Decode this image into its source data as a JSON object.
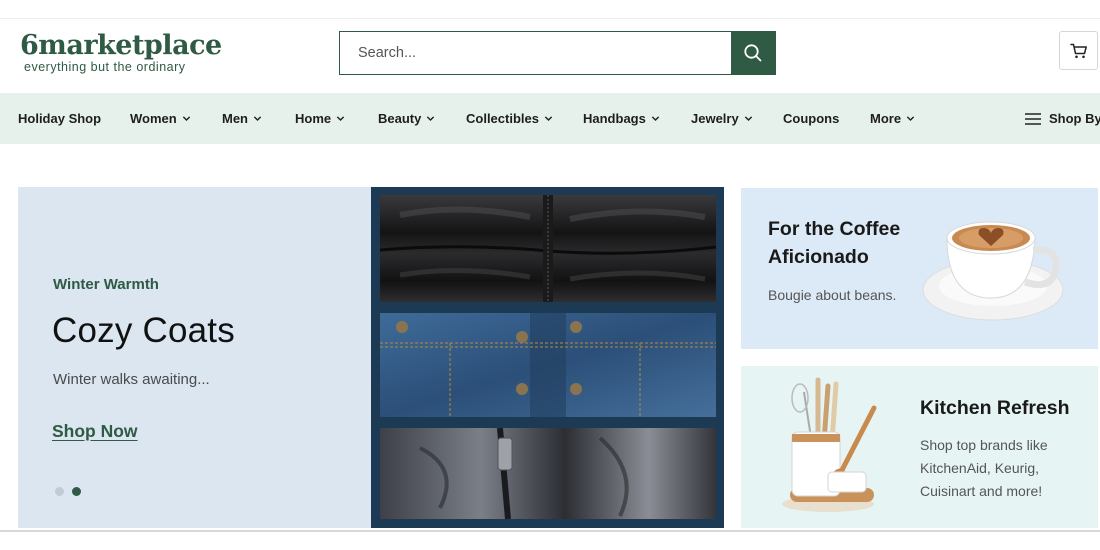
{
  "header": {
    "logo_word": "6marketplace",
    "logo_tagline": "everything but the ordinary",
    "search_placeholder": "Search...",
    "search_icon": "search-icon",
    "cart_icon": "cart-icon"
  },
  "nav": {
    "items": [
      {
        "label": "Holiday Shop",
        "dropdown": false
      },
      {
        "label": "Women",
        "dropdown": true
      },
      {
        "label": "Men",
        "dropdown": true
      },
      {
        "label": "Home",
        "dropdown": true
      },
      {
        "label": "Beauty",
        "dropdown": true
      },
      {
        "label": "Collectibles",
        "dropdown": true
      },
      {
        "label": "Handbags",
        "dropdown": true
      },
      {
        "label": "Jewelry",
        "dropdown": true
      },
      {
        "label": "Coupons",
        "dropdown": false
      },
      {
        "label": "More",
        "dropdown": true
      }
    ],
    "shop_by_label": "Shop By"
  },
  "hero": {
    "eyebrow": "Winter Warmth",
    "title": "Cozy Coats",
    "subtitle": "Winter walks awaiting...",
    "cta": "Shop Now",
    "slides_total": 2,
    "active_slide": 2
  },
  "cards": [
    {
      "title_line1": "For the Coffee",
      "title_line2": "Aficionado",
      "subtitle": "Bougie about beans."
    },
    {
      "title": "Kitchen Refresh",
      "desc_line1": "Shop top brands like",
      "desc_line2": "KitchenAid, Keurig,",
      "desc_line3": "Cuisinart and more!"
    }
  ],
  "colors": {
    "brand_green": "#2f5a44",
    "nav_bg": "#e6f1ec",
    "hero_bg": "#dbe6f1",
    "card1_bg": "#dceaf7",
    "card2_bg": "#e6f4f3"
  }
}
